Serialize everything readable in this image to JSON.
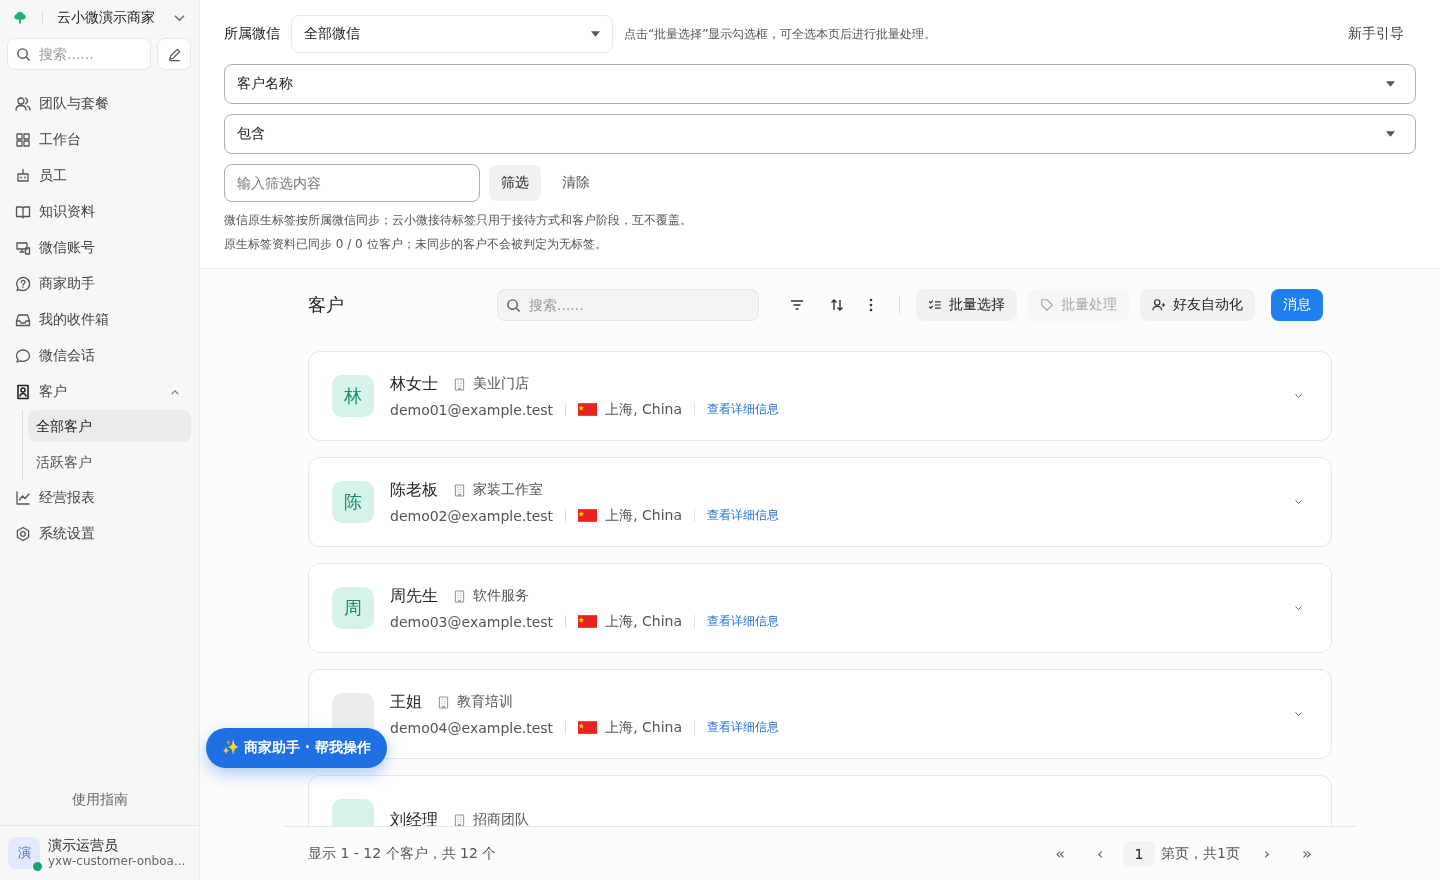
{
  "sidebar": {
    "brand": "云小微演示商家",
    "search": {
      "placeholder": "搜索......"
    },
    "items": [
      {
        "label": "团队与套餐",
        "selected": false
      },
      {
        "label": "工作台",
        "selected": false
      },
      {
        "label": "员工",
        "selected": false
      },
      {
        "label": "知识资料",
        "selected": false
      },
      {
        "label": "微信账号",
        "selected": false
      },
      {
        "label": "商家助手",
        "selected": false
      },
      {
        "label": "我的收件箱",
        "selected": false
      },
      {
        "label": "微信会话",
        "selected": false
      },
      {
        "label": "客户",
        "selected": false,
        "expanded": true,
        "children": [
          {
            "label": "全部客户",
            "selected": true
          },
          {
            "label": "活跃客户",
            "selected": false
          }
        ]
      },
      {
        "label": "经营报表",
        "selected": false
      },
      {
        "label": "系统设置",
        "selected": false
      }
    ],
    "guide": "使用指南",
    "user": {
      "avatar": "演",
      "name": "演示运营员",
      "email": "yxw-customer-onboa...",
      "online": true
    }
  },
  "filters": {
    "account_label": "所属微信",
    "account_select": "全部微信",
    "hint": "点击“批量选择”显示勾选框，可全选本页后进行批量处理。",
    "guide_link": "新手引导",
    "field_select": "客户名称",
    "operator_select": "包含",
    "value_input": {
      "placeholder": "输入筛选内容"
    },
    "apply_button": "筛选",
    "clear_button": "清除",
    "notes": [
      "微信原生标签按所属微信同步；云小微接待标签只用于接待方式和客户阶段，互不覆盖。",
      "原生标签资料已同步 0 / 0 位客户；未同步的客户不会被判定为无标签。"
    ]
  },
  "customers": {
    "title": "客户",
    "search": {
      "placeholder": "搜索......"
    },
    "actions": [
      {
        "label": "批量选择",
        "disabled": false,
        "primary": false
      },
      {
        "label": "批量处理",
        "disabled": true,
        "primary": false
      },
      {
        "label": "好友自动化",
        "disabled": false,
        "primary": false
      },
      {
        "label": "消息",
        "disabled": false,
        "primary": true
      }
    ],
    "list": [
      {
        "avatar": "林",
        "color": "#d5f3e8",
        "name": "林女士",
        "company": "美业门店",
        "email": "demo01@example.test",
        "location": "上海, China",
        "link": "查看详细信息",
        "expanded": false
      },
      {
        "avatar": "陈",
        "color": "#d5f3e8",
        "name": "陈老板",
        "company": "家装工作室",
        "email": "demo02@example.test",
        "location": "上海, China",
        "link": "查看详细信息",
        "expanded": false
      },
      {
        "avatar": "周",
        "color": "#d5f3e8",
        "name": "周先生",
        "company": "软件服务",
        "email": "demo03@example.test",
        "location": "上海, China",
        "link": "查看详细信息",
        "expanded": false
      },
      {
        "color": "#ececec",
        "name": "王姐",
        "company": "教育培训",
        "email": "demo04@example.test",
        "location": "上海, China",
        "link": "查看详细信息",
        "expanded": false
      },
      {
        "color": "#d5f3e8",
        "name": "刘经理",
        "company": "招商团队"
      }
    ],
    "summary": "显示 1 - 12 个客户，共 12 个",
    "pagination": {
      "first": "«",
      "prev": "‹",
      "page": "1",
      "text": "第页，共1页",
      "next": "›",
      "last": "»"
    }
  },
  "assistant_button": "✨ 商家助手 · 帮我操作"
}
